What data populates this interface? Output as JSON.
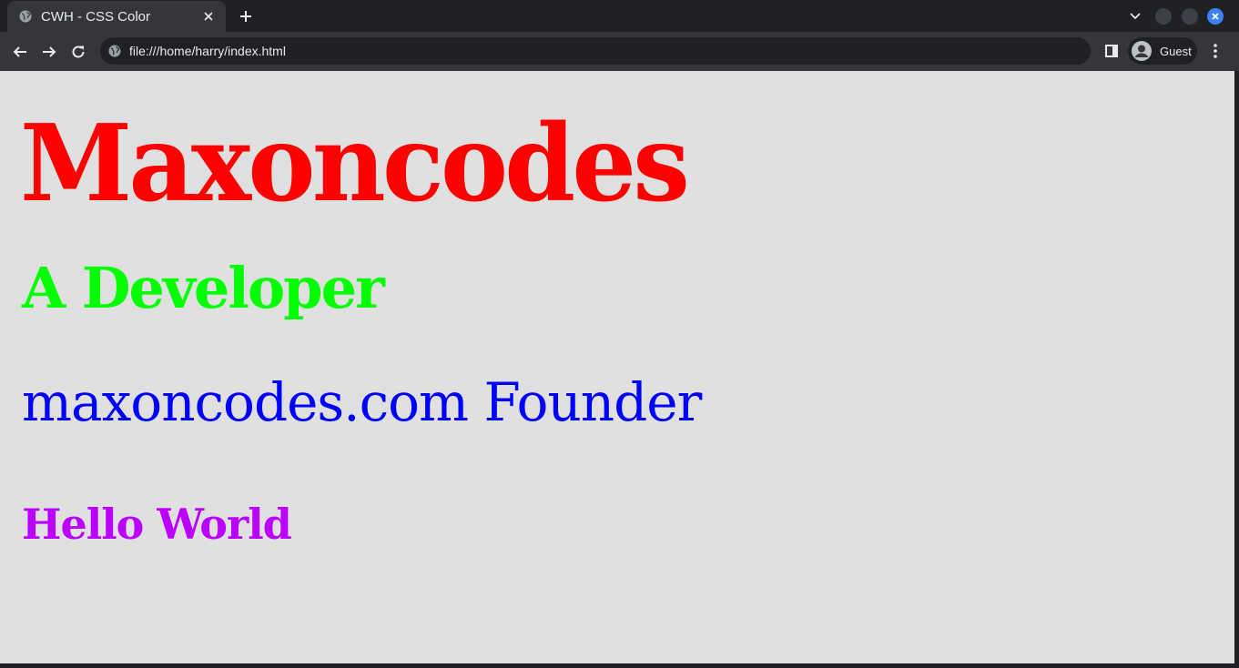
{
  "browser": {
    "tab": {
      "title": "CWH - CSS Color"
    },
    "address": {
      "url": "file:///home/harry/index.html"
    },
    "profile": {
      "label": "Guest"
    }
  },
  "page": {
    "headings": [
      {
        "text": "Maxoncodes",
        "color": "#ff0000"
      },
      {
        "text": "A Developer",
        "color": "#00ff00"
      },
      {
        "text": "maxoncodes.com Founder",
        "color": "#0000ff"
      },
      {
        "text": "Hello World",
        "color": "#bb00ff"
      }
    ],
    "background": "#e0e0e0"
  },
  "colors": {
    "chrome_dark": "#202124",
    "chrome_toolbar": "#35363a",
    "close_accent": "#3b82f6"
  },
  "icons": [
    "globe-icon",
    "close-icon",
    "plus-icon",
    "chevron-down-icon",
    "back-arrow-icon",
    "forward-arrow-icon",
    "reload-icon",
    "side-panel-icon",
    "account-icon",
    "more-vert-icon"
  ]
}
